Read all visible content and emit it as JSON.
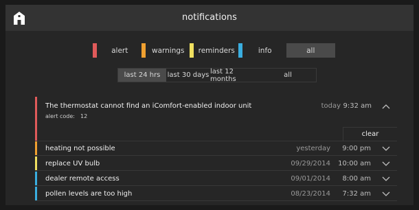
{
  "header": {
    "title": "notifications",
    "home_icon": "home-icon"
  },
  "colors": {
    "alert": "#e05a5a",
    "warnings": "#f0a030",
    "reminders": "#f0e060",
    "info": "#3aaee0"
  },
  "type_filter": {
    "selected": "all",
    "items": [
      {
        "label": "alert",
        "color": "#e05a5a"
      },
      {
        "label": "warnings",
        "color": "#f0a030"
      },
      {
        "label": "reminders",
        "color": "#f0e060"
      },
      {
        "label": "info",
        "color": "#3aaee0"
      },
      {
        "label": "all"
      }
    ]
  },
  "time_filter": {
    "selected": "last 24 hrs",
    "items": [
      {
        "label": "last 24 hrs"
      },
      {
        "label": "last 30 days"
      },
      {
        "label": "last 12 months"
      },
      {
        "label": "all"
      }
    ]
  },
  "notifications": [
    {
      "type": "alert",
      "message": "The thermostat cannot find an iComfort-enabled indoor unit",
      "code_label": "alert code:",
      "code": "12",
      "date": "today",
      "time": "9:32 am",
      "expanded": true,
      "clear_label": "clear"
    },
    {
      "type": "warnings",
      "message": "heating not possible",
      "date": "yesterday",
      "time": "9:00 pm"
    },
    {
      "type": "reminders",
      "message": "replace UV bulb",
      "date": "09/29/2014",
      "time": "10:00 am"
    },
    {
      "type": "info",
      "message": "dealer remote access",
      "date": "09/01/2014",
      "time": "8:00 am"
    },
    {
      "type": "info",
      "message": "pollen levels are too high",
      "date": "08/23/2014",
      "time": "7:32 am"
    }
  ]
}
